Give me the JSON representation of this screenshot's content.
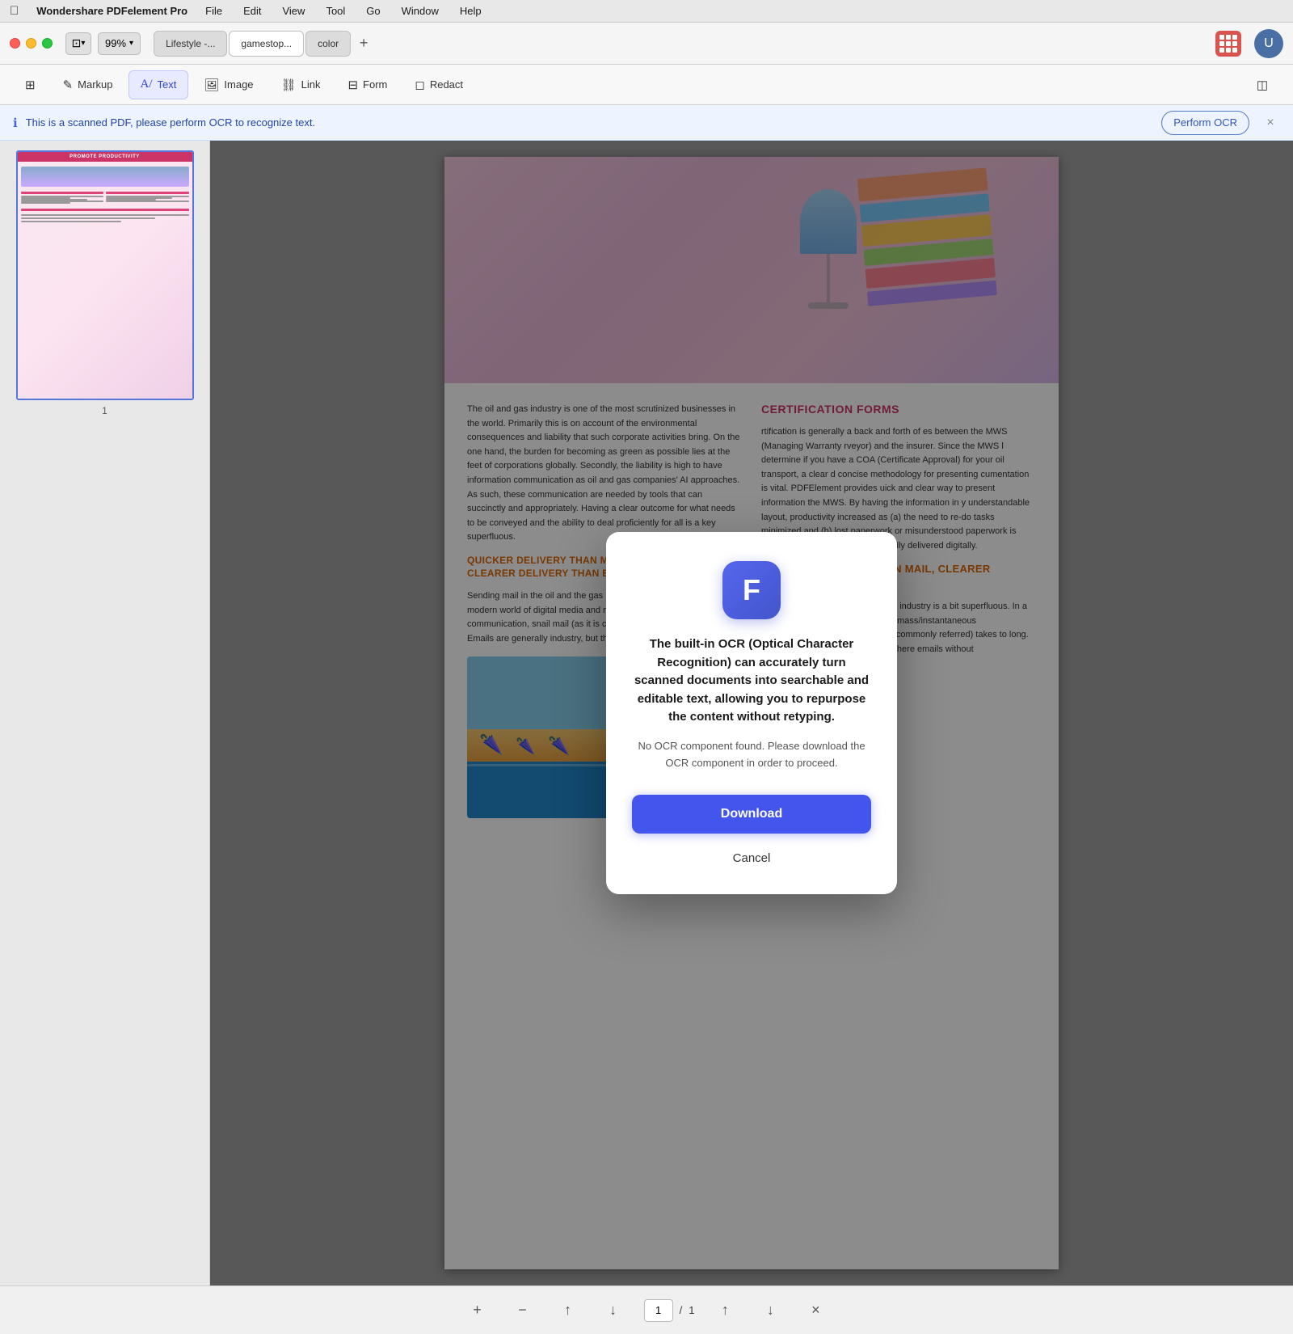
{
  "menubar": {
    "apple": "&#63743;",
    "appName": "Wondershare PDFelement Pro",
    "items": [
      "File",
      "Edit",
      "View",
      "Tool",
      "Go",
      "Window",
      "Help"
    ]
  },
  "toolbar": {
    "zoomLevel": "99%",
    "tabs": [
      {
        "id": "tab1",
        "label": "Lifestyle -...",
        "active": false
      },
      {
        "id": "tab2",
        "label": "gamestop...",
        "active": true
      },
      {
        "id": "tab3",
        "label": "color",
        "active": false
      }
    ],
    "addTab": "+",
    "avatarLabel": "U"
  },
  "tools": {
    "items": [
      {
        "id": "pages",
        "icon": "⊞",
        "label": ""
      },
      {
        "id": "markup",
        "icon": "✏️",
        "label": "Markup"
      },
      {
        "id": "text",
        "icon": "A",
        "label": "Text",
        "active": true
      },
      {
        "id": "image",
        "icon": "🖼",
        "label": "Image"
      },
      {
        "id": "link",
        "icon": "🔗",
        "label": "Link"
      },
      {
        "id": "form",
        "icon": "⊞",
        "label": "Form"
      },
      {
        "id": "redact",
        "icon": "◻",
        "label": "Redact"
      },
      {
        "id": "panel",
        "icon": "◫",
        "label": ""
      }
    ]
  },
  "ocrBanner": {
    "message": "This is a scanned PDF, please perform OCR to recognize text.",
    "buttonLabel": "Perform OCR",
    "closeIcon": "×"
  },
  "sidebar": {
    "pageNumber": "1",
    "thumbHeader": "PROMOTE PRODUCTIVITY"
  },
  "pdf": {
    "leftText1": "The oil and gas industry is one of the most scrutinized businesses in the world. Primarily this is on account of the environmental consequences and liability that such corporate activities bring. On the one hand, the burden for becoming as green as possible lies at the feet of corporations globally. Secondly, the liability is high to have information communication as oil and gas companies' AI approaches. As such, these communication are needed by tools that can succinctly and appropriately. Having a clear outcome for what needs to be conveyed and the ability to deal proficiently for all is a key superfluous.",
    "leftText2": "Sending mail in the oil and the gas industry is a bit superfluous. In a modern world of digital media and mass/instantaneous communication, snail mail (as it is commonly referred) takes to long. Emails are generally industry, but there emails without",
    "sectionTitle1": "CERTIFICATION FORMS",
    "rightText1": "rtification is generally a back and forth of es between the MWS (Managing Warranty rveyor) and the insurer. Since the MWS l determine if you have a COA (Certificate Approval) for your oil transport, a clear d concise methodology for presenting cumentation is vital. PDFElement provides uick and clear way to present information the MWS. By having the information in y understandable layout, productivity increased as (a) the need to re-do tasks minimized and (b) lost paperwork or misunderstood paperwork is greatly reduced as PDFs as typically delivered digitally.",
    "sectionTitle2": "QUICKER DELIVERY THAN MAIL, CLEARER DELIVERY THAN EMAIL",
    "rightText2": "Sending mail in the oil and the gas industry is a bit superfluous. In a modern world of digital media and mass/instantaneous communication, snail mail (as it is commonly referred) takes to long. Emails are generally industry, but there emails without"
  },
  "modal": {
    "iconText": "F",
    "title": "The built-in OCR (Optical Character Recognition) can accurately turn scanned documents into searchable and editable text, allowing you to repurpose the content without retyping.",
    "description": "No OCR component found. Please download the OCR component in order to proceed.",
    "downloadLabel": "Download",
    "cancelLabel": "Cancel"
  },
  "bottomBar": {
    "addIcon": "+",
    "minusIcon": "−",
    "uploadIcon": "↑",
    "downloadIcon": "↓",
    "pageInput": "1",
    "pageSeparator": "/",
    "totalPages": "1",
    "prevIcon": "↑",
    "nextIcon": "↓",
    "closeIcon": "×"
  },
  "colors": {
    "accent": "#4455ee",
    "ocr_border": "#5577cc",
    "section_pink": "#cc3366",
    "section_orange": "#dd6600",
    "tab_active_bg": "#ffffff",
    "grid_btn_bg": "#d9534f"
  }
}
